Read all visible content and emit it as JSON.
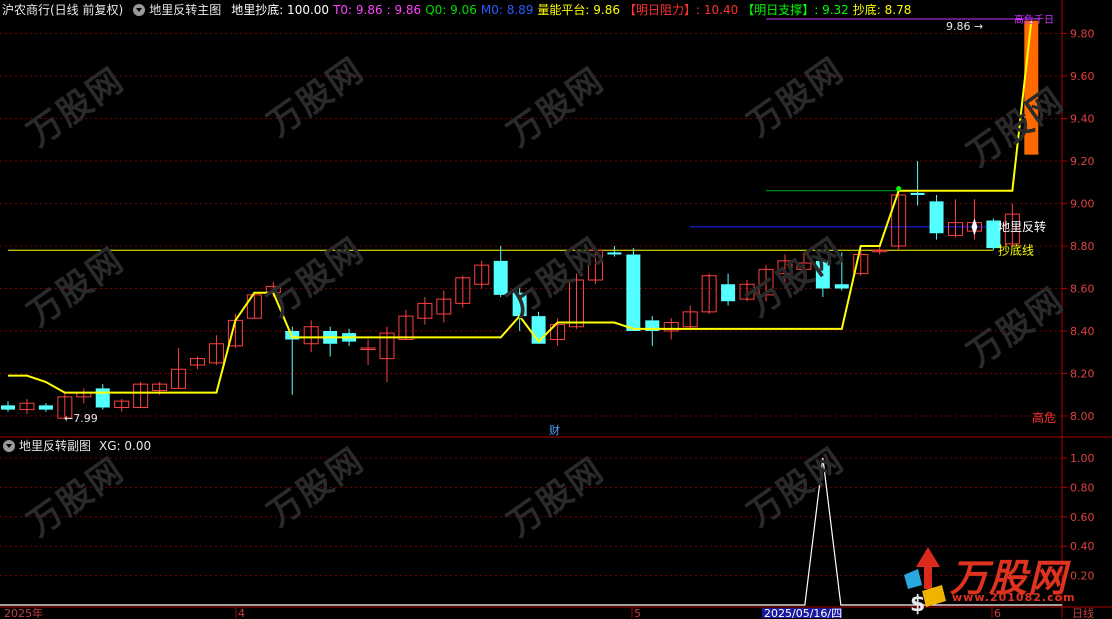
{
  "header": {
    "stock": "沪农商行(日线 前复权)",
    "indicator": "地里反转主图",
    "items": [
      {
        "label": "地里抄底: 100.00",
        "color": "#ffffff"
      },
      {
        "label": "T0: 9.86",
        "color": "#ff44ff"
      },
      {
        "label": ": 9.86",
        "color": "#ff44ff"
      },
      {
        "label": "Q0: 9.06",
        "color": "#00dd00"
      },
      {
        "label": "M0: 8.89",
        "color": "#2c5cff"
      },
      {
        "label": "量能平台: 9.86",
        "color": "#ffff00"
      },
      {
        "label": "【明日阻力】: 10.40",
        "color": "#ff3030"
      },
      {
        "label": "【明日支撑】: 9.32",
        "color": "#00ff00"
      },
      {
        "label": "抄底: 8.78",
        "color": "#ffff00"
      }
    ]
  },
  "sub_header": {
    "indicator": "地里反转副图",
    "value": "XG: 0.00"
  },
  "labels": {
    "reversal": "地里反转",
    "bottom_line": "抄底线",
    "low_marker": "7.99",
    "high_marker": "9.86",
    "danger": "高危",
    "finance": "财",
    "top_tag": "高危千日",
    "date_left": "2025年",
    "date_4": "4",
    "date_5": "5",
    "date_sel": "2025/05/16/四",
    "date_6": "6",
    "period": "日线"
  },
  "logo": {
    "name": "万股网",
    "url": "www.201082.com"
  },
  "watermark": "万股网",
  "colors": {
    "up": "#ff4040",
    "down": "#54ffff",
    "line_yellow": "#ffff00",
    "grid": "#7a0000",
    "axis_border": "#b00000",
    "blue_line": "#2020ff",
    "green_line": "#00aa00",
    "purple_line": "#cc33ff",
    "bar_orange": "#ff6a00"
  },
  "chart_data": [
    {
      "type": "candlestick",
      "title": "沪农商行(日线 前复权)",
      "ylim": [
        7.9,
        10.0
      ],
      "yticks": [
        8.0,
        8.2,
        8.4,
        8.6,
        8.8,
        9.0,
        9.2,
        9.4,
        9.6,
        9.8
      ],
      "candles": [
        {
          "o": 8.05,
          "h": 8.07,
          "l": 8.02,
          "c": 8.03
        },
        {
          "o": 8.03,
          "h": 8.08,
          "l": 8.01,
          "c": 8.06
        },
        {
          "o": 8.05,
          "h": 8.06,
          "l": 8.02,
          "c": 8.03
        },
        {
          "o": 7.99,
          "h": 8.11,
          "l": 7.99,
          "c": 8.09
        },
        {
          "o": 8.09,
          "h": 8.13,
          "l": 8.06,
          "c": 8.11
        },
        {
          "o": 8.13,
          "h": 8.15,
          "l": 8.03,
          "c": 8.04
        },
        {
          "o": 8.04,
          "h": 8.08,
          "l": 8.02,
          "c": 8.07
        },
        {
          "o": 8.04,
          "h": 8.16,
          "l": 8.04,
          "c": 8.15
        },
        {
          "o": 8.12,
          "h": 8.16,
          "l": 8.1,
          "c": 8.15
        },
        {
          "o": 8.13,
          "h": 8.32,
          "l": 8.13,
          "c": 8.22
        },
        {
          "o": 8.24,
          "h": 8.28,
          "l": 8.22,
          "c": 8.27
        },
        {
          "o": 8.25,
          "h": 8.38,
          "l": 8.24,
          "c": 8.34
        },
        {
          "o": 8.33,
          "h": 8.48,
          "l": 8.32,
          "c": 8.45
        },
        {
          "o": 8.46,
          "h": 8.57,
          "l": 8.46,
          "c": 8.57
        },
        {
          "o": 8.58,
          "h": 8.63,
          "l": 8.56,
          "c": 8.61
        },
        {
          "o": 8.4,
          "h": 8.42,
          "l": 8.1,
          "c": 8.36
        },
        {
          "o": 8.34,
          "h": 8.45,
          "l": 8.3,
          "c": 8.42
        },
        {
          "o": 8.4,
          "h": 8.42,
          "l": 8.28,
          "c": 8.34
        },
        {
          "o": 8.39,
          "h": 8.41,
          "l": 8.33,
          "c": 8.35
        },
        {
          "o": 8.32,
          "h": 8.36,
          "l": 8.24,
          "c": 8.32
        },
        {
          "o": 8.27,
          "h": 8.42,
          "l": 8.16,
          "c": 8.39
        },
        {
          "o": 8.36,
          "h": 8.5,
          "l": 8.36,
          "c": 8.47
        },
        {
          "o": 8.46,
          "h": 8.56,
          "l": 8.43,
          "c": 8.53
        },
        {
          "o": 8.48,
          "h": 8.59,
          "l": 8.44,
          "c": 8.55
        },
        {
          "o": 8.53,
          "h": 8.66,
          "l": 8.51,
          "c": 8.65
        },
        {
          "o": 8.62,
          "h": 8.73,
          "l": 8.6,
          "c": 8.71
        },
        {
          "o": 8.73,
          "h": 8.8,
          "l": 8.56,
          "c": 8.57
        },
        {
          "o": 8.58,
          "h": 8.61,
          "l": 8.4,
          "c": 8.47
        },
        {
          "o": 8.47,
          "h": 8.49,
          "l": 8.34,
          "c": 8.34
        },
        {
          "o": 8.36,
          "h": 8.46,
          "l": 8.33,
          "c": 8.43
        },
        {
          "o": 8.42,
          "h": 8.67,
          "l": 8.41,
          "c": 8.64
        },
        {
          "o": 8.64,
          "h": 8.79,
          "l": 8.62,
          "c": 8.78
        },
        {
          "o": 8.77,
          "h": 8.8,
          "l": 8.75,
          "c": 8.76
        },
        {
          "o": 8.76,
          "h": 8.79,
          "l": 8.4,
          "c": 8.4
        },
        {
          "o": 8.45,
          "h": 8.47,
          "l": 8.33,
          "c": 8.4
        },
        {
          "o": 8.4,
          "h": 8.46,
          "l": 8.36,
          "c": 8.44
        },
        {
          "o": 8.42,
          "h": 8.52,
          "l": 8.41,
          "c": 8.49
        },
        {
          "o": 8.49,
          "h": 8.67,
          "l": 8.48,
          "c": 8.66
        },
        {
          "o": 8.62,
          "h": 8.67,
          "l": 8.52,
          "c": 8.54
        },
        {
          "o": 8.55,
          "h": 8.64,
          "l": 8.54,
          "c": 8.62
        },
        {
          "o": 8.57,
          "h": 8.71,
          "l": 8.54,
          "c": 8.69
        },
        {
          "o": 8.67,
          "h": 8.76,
          "l": 8.6,
          "c": 8.73
        },
        {
          "o": 8.69,
          "h": 8.77,
          "l": 8.66,
          "c": 8.72
        },
        {
          "o": 8.73,
          "h": 8.74,
          "l": 8.56,
          "c": 8.6
        },
        {
          "o": 8.62,
          "h": 8.77,
          "l": 8.59,
          "c": 8.6
        },
        {
          "o": 8.67,
          "h": 8.78,
          "l": 8.66,
          "c": 8.76
        },
        {
          "o": 8.78,
          "h": 8.81,
          "l": 8.76,
          "c": 8.78
        },
        {
          "o": 8.8,
          "h": 9.06,
          "l": 8.78,
          "c": 9.04
        },
        {
          "o": 9.05,
          "h": 9.2,
          "l": 8.99,
          "c": 9.04
        },
        {
          "o": 9.01,
          "h": 9.04,
          "l": 8.83,
          "c": 8.86
        },
        {
          "o": 8.85,
          "h": 9.02,
          "l": 8.84,
          "c": 8.91
        },
        {
          "o": 8.87,
          "h": 9.02,
          "l": 8.83,
          "c": 8.91
        },
        {
          "o": 8.92,
          "h": 8.93,
          "l": 8.78,
          "c": 8.79
        },
        {
          "o": 8.81,
          "h": 9.0,
          "l": 8.8,
          "c": 8.95
        },
        {
          "o": 9.23,
          "h": 9.86,
          "l": 9.23,
          "c": 9.86
        }
      ],
      "yellow_line": [
        8.19,
        8.19,
        8.16,
        8.11,
        8.11,
        8.11,
        8.11,
        8.11,
        8.11,
        8.11,
        8.11,
        8.11,
        8.45,
        8.58,
        8.58,
        8.37,
        8.37,
        8.37,
        8.37,
        8.37,
        8.37,
        8.37,
        8.37,
        8.37,
        8.37,
        8.37,
        8.37,
        8.47,
        8.35,
        8.44,
        8.44,
        8.44,
        8.44,
        8.41,
        8.41,
        8.41,
        8.41,
        8.41,
        8.41,
        8.41,
        8.41,
        8.41,
        8.41,
        8.41,
        8.41,
        8.8,
        8.8,
        9.06,
        9.06,
        9.06,
        9.06,
        9.06,
        9.06,
        9.06,
        9.86
      ],
      "reference_lines": [
        {
          "name": "抄底线",
          "value": 8.78
        },
        {
          "name": "地里反转",
          "value": 8.89
        },
        {
          "name": "Q0",
          "value": 9.06
        },
        {
          "name": "T0",
          "value": 9.86
        }
      ]
    },
    {
      "type": "line",
      "title": "地里反转副图",
      "ylim": [
        0,
        1.05
      ],
      "yticks": [
        0.2,
        0.4,
        0.6,
        0.8,
        1.0
      ],
      "series": [
        {
          "name": "XG",
          "spike_index": 43,
          "values": [
            0,
            1,
            0
          ]
        }
      ]
    }
  ]
}
